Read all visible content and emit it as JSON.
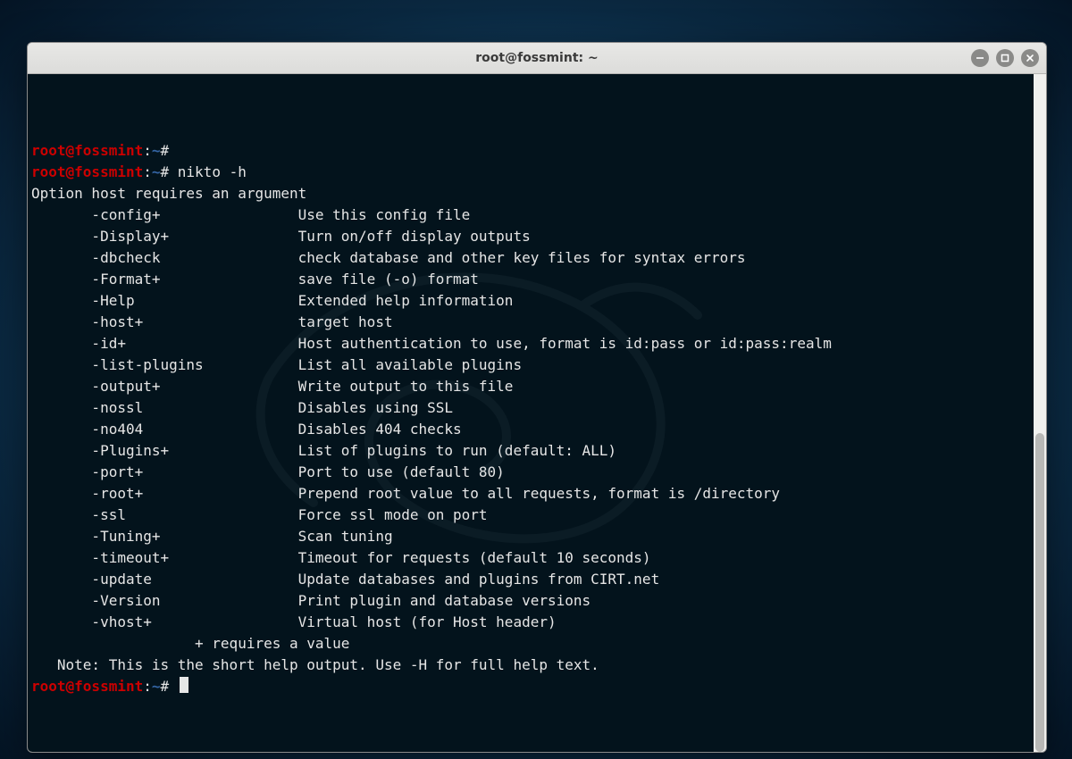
{
  "window": {
    "title": "root@fossmint: ~"
  },
  "prompt": {
    "user_host": "root@fossmint",
    "separator": ":",
    "path": "~",
    "symbol": "#"
  },
  "commands": {
    "line1_cmd": "",
    "line2_cmd": "nikto -h"
  },
  "output": {
    "error": "Option host requires an argument",
    "options": [
      {
        "flag": "-config+",
        "desc": "Use this config file"
      },
      {
        "flag": "-Display+",
        "desc": "Turn on/off display outputs"
      },
      {
        "flag": "-dbcheck",
        "desc": "check database and other key files for syntax errors"
      },
      {
        "flag": "-Format+",
        "desc": "save file (-o) format"
      },
      {
        "flag": "-Help",
        "desc": "Extended help information"
      },
      {
        "flag": "-host+",
        "desc": "target host"
      },
      {
        "flag": "-id+",
        "desc": "Host authentication to use, format is id:pass or id:pass:realm"
      },
      {
        "flag": "-list-plugins",
        "desc": "List all available plugins"
      },
      {
        "flag": "-output+",
        "desc": "Write output to this file"
      },
      {
        "flag": "-nossl",
        "desc": "Disables using SSL"
      },
      {
        "flag": "-no404",
        "desc": "Disables 404 checks"
      },
      {
        "flag": "-Plugins+",
        "desc": "List of plugins to run (default: ALL)"
      },
      {
        "flag": "-port+",
        "desc": "Port to use (default 80)"
      },
      {
        "flag": "-root+",
        "desc": "Prepend root value to all requests, format is /directory"
      },
      {
        "flag": "-ssl",
        "desc": "Force ssl mode on port"
      },
      {
        "flag": "-Tuning+",
        "desc": "Scan tuning"
      },
      {
        "flag": "-timeout+",
        "desc": "Timeout for requests (default 10 seconds)"
      },
      {
        "flag": "-update",
        "desc": "Update databases and plugins from CIRT.net"
      },
      {
        "flag": "-Version",
        "desc": "Print plugin and database versions"
      },
      {
        "flag": "-vhost+",
        "desc": "Virtual host (for Host header)"
      }
    ],
    "requires_value": "   + requires a value",
    "note": "Note: This is the short help output. Use -H for full help text."
  },
  "layout": {
    "option_indent": "       ",
    "flag_width": 24,
    "note_indent": "   ",
    "requires_indent": "                "
  },
  "scrollbar": {
    "thumb_top_pct": 53,
    "thumb_height_pct": 47
  }
}
